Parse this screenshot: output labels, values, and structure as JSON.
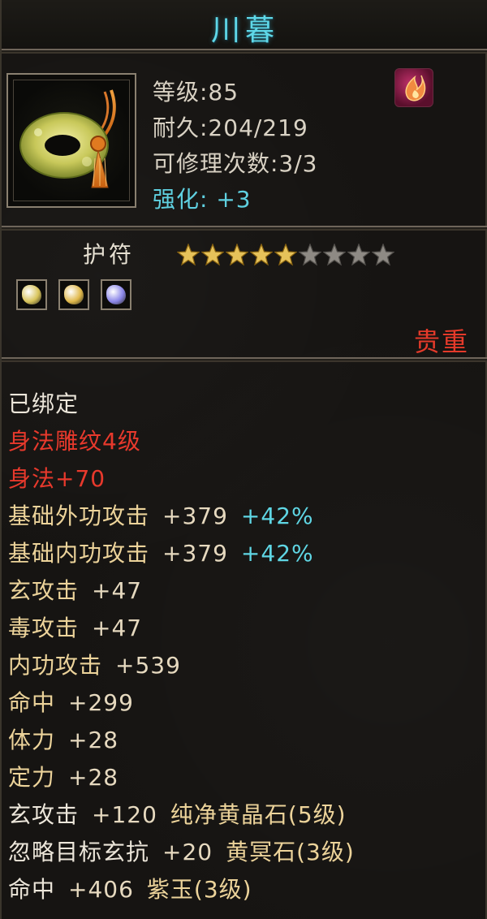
{
  "item": {
    "name": "川暮",
    "level_label": "等级:85",
    "durability_label": "耐久:204/219",
    "repair_label": "可修理次数:3/3",
    "enhance_label": "强化: +3",
    "type": "护符",
    "stars": {
      "filled": 5,
      "total": 9
    },
    "rarity": "贵重",
    "colors": {
      "title": "#5fd8e8",
      "rarity": "#e43a2a",
      "accent": "#5fd6e4"
    }
  },
  "gems": [
    {
      "icon": "yellow-gem-icon",
      "color": "#d8c35a"
    },
    {
      "icon": "gold-gem-icon",
      "color": "#e0b84a"
    },
    {
      "icon": "purple-gem-icon",
      "color": "#8b86e8"
    }
  ],
  "attributes": [
    {
      "label": "已绑定",
      "value": "",
      "extra": ""
    },
    {
      "label": "身法雕纹4级",
      "value": "",
      "extra": ""
    },
    {
      "label": "身法+70",
      "value": "",
      "extra": ""
    },
    {
      "label": "基础外功攻击",
      "value": "+379",
      "extra": "+42%"
    },
    {
      "label": "基础内功攻击",
      "value": "+379",
      "extra": "+42%"
    },
    {
      "label": "玄攻击",
      "value": "+47",
      "extra": ""
    },
    {
      "label": "毒攻击",
      "value": "+47",
      "extra": ""
    },
    {
      "label": "内功攻击",
      "value": "+539",
      "extra": ""
    },
    {
      "label": "命中",
      "value": "+299",
      "extra": ""
    },
    {
      "label": "体力",
      "value": "+28",
      "extra": ""
    },
    {
      "label": "定力",
      "value": "+28",
      "extra": ""
    },
    {
      "label": "玄攻击",
      "value": "+120",
      "extra": "纯净黄晶石(5级)"
    },
    {
      "label": "忽略目标玄抗",
      "value": "+20",
      "extra": "黄冥石(3级)"
    },
    {
      "label": "命中",
      "value": "+406",
      "extra": "紫玉(3级)"
    }
  ]
}
